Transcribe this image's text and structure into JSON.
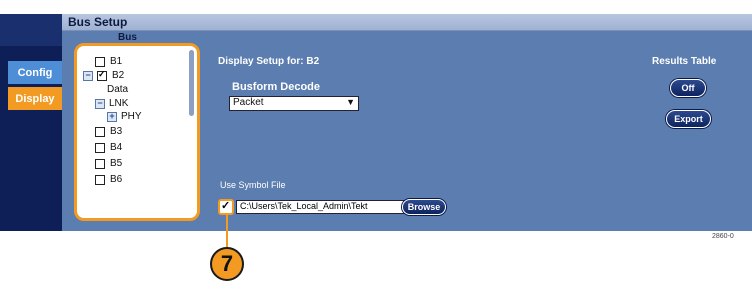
{
  "window": {
    "title": "Bus Setup"
  },
  "sidebar": {
    "tabs": [
      {
        "label": "Config"
      },
      {
        "label": "Display"
      }
    ]
  },
  "bus_panel": {
    "title": "Bus",
    "items": [
      {
        "label": "B1",
        "checked": false
      },
      {
        "label": "B2",
        "checked": true,
        "expanded": true
      },
      {
        "label": "Data"
      },
      {
        "label": "LNK",
        "expanded": true
      },
      {
        "label": "PHY",
        "expanded": false
      },
      {
        "label": "B3",
        "checked": false
      },
      {
        "label": "B4",
        "checked": false
      },
      {
        "label": "B5",
        "checked": false
      },
      {
        "label": "B6",
        "checked": false
      }
    ]
  },
  "display_setup": {
    "label": "Display Setup for:  B2",
    "busform_label": "Busform Decode",
    "busform_value": "Packet"
  },
  "results_table": {
    "label": "Results Table",
    "off_label": "Off",
    "export_label": "Export"
  },
  "symbol_file": {
    "label": "Use Symbol File",
    "checked": true,
    "path": "C:\\Users\\Tek_Local_Admin\\Tekt",
    "browse_label": "Browse"
  },
  "callout": {
    "number": "7"
  },
  "figure_id": "2860-0"
}
